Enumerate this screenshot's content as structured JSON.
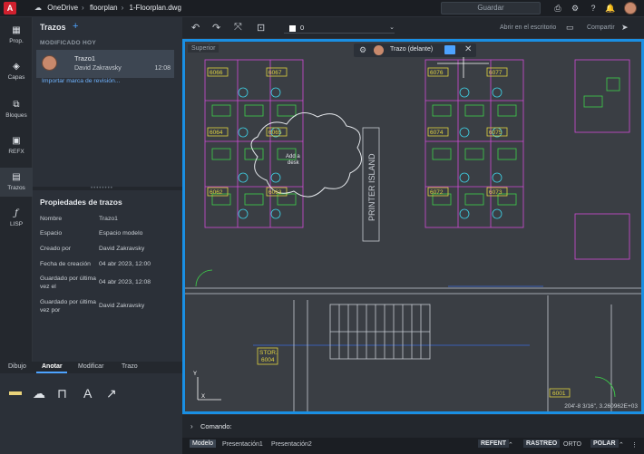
{
  "app": {
    "logo": "A",
    "breadcrumb": [
      "OneDrive",
      "floorplan",
      "1-Floorplan.dwg"
    ],
    "save_label": "Guardar"
  },
  "rail": [
    {
      "label": "Prop.",
      "icon": "properties-icon"
    },
    {
      "label": "Capas",
      "icon": "layers-icon"
    },
    {
      "label": "Bloques",
      "icon": "blocks-icon"
    },
    {
      "label": "REFX",
      "icon": "xref-icon"
    },
    {
      "label": "Trazos",
      "icon": "traces-icon"
    },
    {
      "label": "LISP",
      "icon": "lisp-icon"
    }
  ],
  "panel": {
    "title": "Trazos",
    "section": "MODIFICADO HOY",
    "trace": {
      "name": "Trazo1",
      "user": "David Zakravsky",
      "time": "12:08"
    },
    "import_link": "Importar marca de revisión...",
    "props_title": "Propiedades de trazos",
    "props": [
      {
        "k": "Nombre",
        "v": "Trazo1"
      },
      {
        "k": "Espacio",
        "v": "Espacio modelo"
      },
      {
        "k": "Creado por",
        "v": "David Zakravsky"
      },
      {
        "k": "Fecha de creación",
        "v": "04 abr 2023, 12:00"
      },
      {
        "k": "Guardado por última vez el",
        "v": "04 abr 2023, 12:08"
      },
      {
        "k": "Guardado por última vez por",
        "v": "David Zakravsky"
      }
    ]
  },
  "bottom_tabs": [
    "Dibujo",
    "Anotar",
    "Modificar",
    "Trazo"
  ],
  "toolbar": {
    "layer": "0",
    "open_desktop": "Abrir en el escritorio",
    "share": "Compartir"
  },
  "canvas": {
    "viewport_label": "Superior",
    "trace_pill": "Trazo (delante)",
    "coords": "204'-8 3/16\", 3.260962E+03",
    "rooms": [
      "6066",
      "6067",
      "6064",
      "6065",
      "6062",
      "6063",
      "6076",
      "6077",
      "6074",
      "6075",
      "6072",
      "6073",
      "6004",
      "6001"
    ],
    "cloud_text": [
      "Add a",
      "desk"
    ],
    "island_text": "PRINTER ISLAND",
    "stor_text": "STOR."
  },
  "command": {
    "label": "Comando:"
  },
  "status": {
    "tabs": [
      "Modelo",
      "Presentación1",
      "Presentación2"
    ],
    "buttons": [
      "REFENT",
      "RASTREO",
      "ORTO",
      "POLAR"
    ]
  },
  "colors": {
    "accent": "#1a8fe3",
    "canvas": "#3a3e44",
    "walls": "#c7ccd3",
    "magenta": "#d04bd6",
    "green": "#3ed24a",
    "cyan": "#3fd3e8",
    "yellow": "#e0d341",
    "red": "#e04040"
  }
}
